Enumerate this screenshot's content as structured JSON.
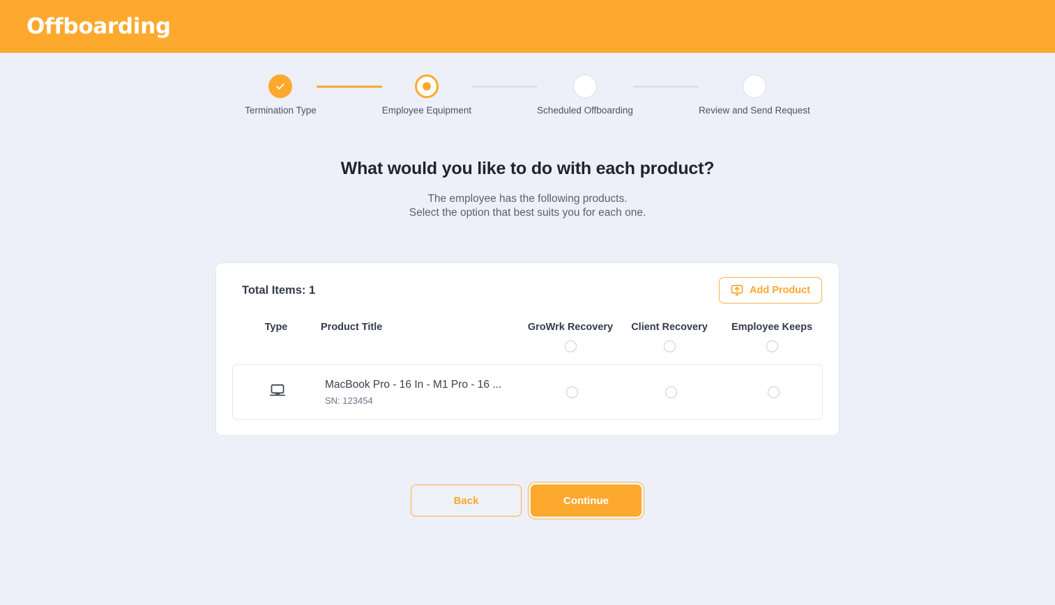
{
  "header": {
    "title": "Offboarding",
    "bg_color": "#fca92e"
  },
  "stepper": {
    "steps": [
      {
        "label": "Termination Type",
        "state": "done"
      },
      {
        "label": "Employee Equipment",
        "state": "active"
      },
      {
        "label": "Scheduled Offboarding",
        "state": "todo"
      },
      {
        "label": "Review and Send Request",
        "state": "todo"
      }
    ],
    "active_color": "#fca92e",
    "inactive_color": "#dcdfe8"
  },
  "content": {
    "headline": "What would you like to do with each product?",
    "subline_1": "The employee has the following products.",
    "subline_2": "Select the option that best suits you for each one."
  },
  "card": {
    "total_items_label": "Total Items: 1",
    "add_product_label": "Add Product",
    "add_product_icon": "monitor-upload-icon",
    "columns": {
      "type": "Type",
      "product_title": "Product Title",
      "growrk_recovery": "GroWrk Recovery",
      "client_recovery": "Client Recovery",
      "employee_keeps": "Employee Keeps"
    },
    "select_all_radios": {
      "growrk_recovery": false,
      "client_recovery": false,
      "employee_keeps": false
    },
    "rows": [
      {
        "type_icon": "laptop-icon",
        "title": "MacBook Pro - 16 In - M1 Pro - 16 ...",
        "serial": "SN: 123454",
        "growrk_recovery": false,
        "client_recovery": false,
        "employee_keeps": false
      }
    ]
  },
  "footer": {
    "back_label": "Back",
    "continue_label": "Continue",
    "continue_focused": true
  }
}
